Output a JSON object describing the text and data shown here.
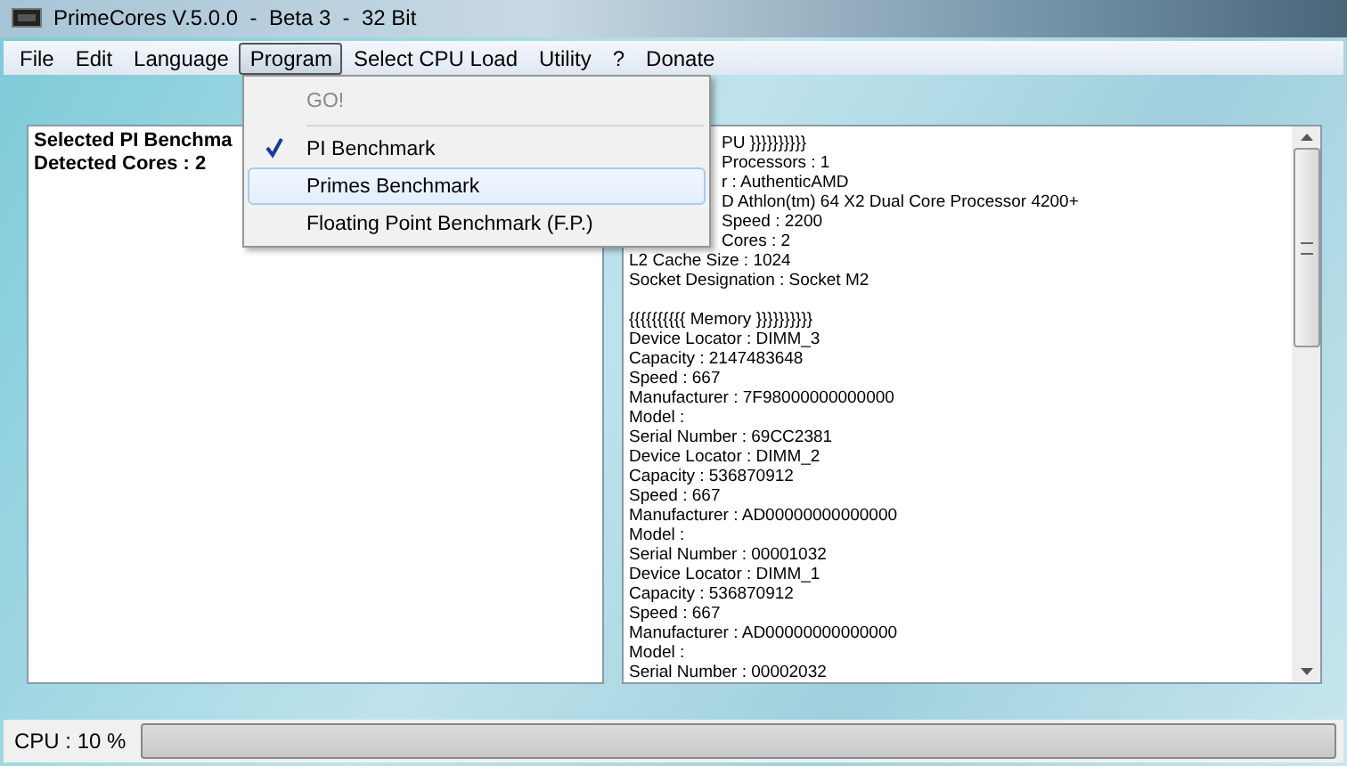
{
  "window": {
    "title": "PrimeCores V.5.0.0  -  Beta 3  -  32 Bit"
  },
  "menu_bar": [
    {
      "label": "File",
      "selected": false
    },
    {
      "label": "Edit",
      "selected": false
    },
    {
      "label": "Language",
      "selected": false
    },
    {
      "label": "Program",
      "selected": true
    },
    {
      "label": "Select CPU Load",
      "selected": false
    },
    {
      "label": "Utility",
      "selected": false
    },
    {
      "label": "?",
      "selected": false
    },
    {
      "label": "Donate",
      "selected": false
    }
  ],
  "dropdown": [
    {
      "label": "GO!",
      "disabled": true,
      "checked": false,
      "selected": false,
      "separator_after": true
    },
    {
      "label": "PI Benchmark",
      "disabled": false,
      "checked": true,
      "selected": false,
      "separator_after": false
    },
    {
      "label": "Primes Benchmark",
      "disabled": false,
      "checked": false,
      "selected": true,
      "separator_after": false
    },
    {
      "label": "Floating Point Benchmark (F.P.)",
      "disabled": false,
      "checked": false,
      "selected": false,
      "separator_after": false
    }
  ],
  "left_panel": {
    "lines": [
      "Selected PI Benchma",
      "Detected Cores : 2"
    ]
  },
  "right_panel": {
    "hidden_part_lines": [
      "PU }}}}}}}}}}",
      "Processors  : 1",
      "r : AuthenticAMD",
      "D Athlon(tm) 64 X2 Dual Core Processor 4200+",
      "Speed : 2200",
      "Cores : 2"
    ],
    "cpu_lines": [
      "L2 Cache Size : 1024",
      "Socket Designation : Socket M2"
    ],
    "memory_lines": [
      "{{{{{{{{{{ Memory }}}}}}}}}}",
      "Device Locator : DIMM_3",
      "Capacity : 2147483648",
      "Speed : 667",
      "Manufacturer : 7F98000000000000",
      "Model :",
      "Serial Number : 69CC2381",
      "Device Locator : DIMM_2",
      "Capacity : 536870912",
      "Speed : 667",
      "Manufacturer : AD00000000000000",
      "Model :",
      "Serial Number : 00001032",
      "Device Locator : DIMM_1",
      "Capacity : 536870912",
      "Speed : 667",
      "Manufacturer : AD00000000000000",
      "Model :",
      "Serial Number : 00002032"
    ]
  },
  "status_bar": {
    "label": "CPU : 10 %",
    "level": 0
  }
}
